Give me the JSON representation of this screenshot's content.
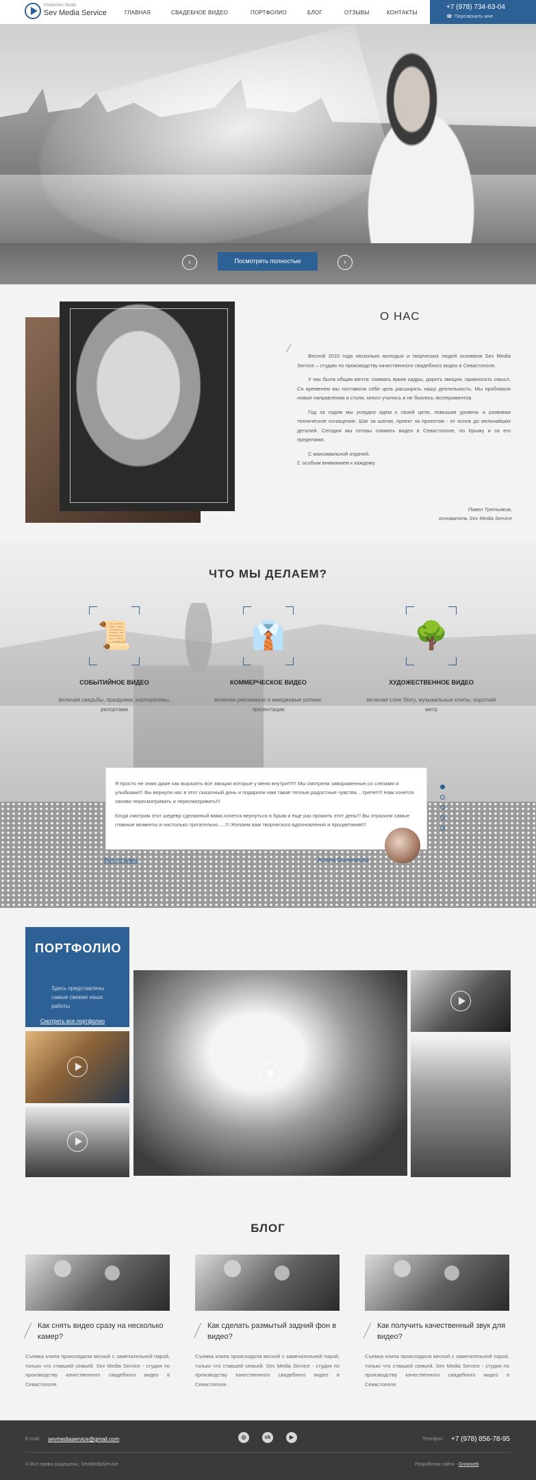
{
  "header": {
    "logo_small": "Production Studio",
    "logo_big": "Sev Media Service",
    "nav": [
      "ГЛАВНАЯ",
      "СВАДЕБНОЕ ВИДЕО",
      "ПОРТФОЛИО",
      "БЛОГ",
      "ОТЗЫВЫ",
      "КОНТАКТЫ"
    ],
    "phone": "+7 (978) 734-63-04",
    "callback": "Перезвонить мне"
  },
  "hero": {
    "button": "Посмотреть полностью",
    "prev_arrow": "‹",
    "next_arrow": "›"
  },
  "about": {
    "title": "О НАС",
    "paragraphs": [
      "Весной 2010 года несколько молодых и творческих людей основали Sev Media Service – студию по производству качественного свадебного видео в Севастополе.",
      "У нас была общая мечта: снимать яркие кадры, дарить эмоции, привносить смысл. Со временем мы поставили себе цель расширить нашу деятельность. Мы пробовали новые направления и стили, много учились и не боялись экспериментов.",
      "Год за годом мы усердно идем к своей цели, повышая уровень и развивая техническое оснащение. Шаг за шагом, проект за проектом - от основ до мельчайших деталей. Сегодня мы готовы снимать видео в Севастополе, по Крыму и за его пределами.",
      "С максимальной отдачей.\nС особым вниманием к каждому."
    ],
    "sign_name": "Павел Третьяков,",
    "sign_role": "основатель Sev Media Service"
  },
  "services": {
    "title": "ЧТО МЫ ДЕЛАЕМ?",
    "items": [
      {
        "icon": "scroll-icon",
        "glyph": "📜",
        "title": "СОБЫТИЙНОЕ ВИДЕО",
        "desc": "включая свадьбы, праздники, корпоративы, репортажи"
      },
      {
        "icon": "tie-icon",
        "glyph": "👔",
        "title": "КОММЕРЧЕСКОЕ ВИДЕО",
        "desc": "включая рекламные и имиджевые ролики, презентации"
      },
      {
        "icon": "tree-icon",
        "glyph": "🌳",
        "title": "ХУДОЖЕСТВЕННОЕ ВИДЕО",
        "desc": "включая Love Story, музыкальные клипы, короткий метр"
      }
    ]
  },
  "review": {
    "p1": "Я просто не знаю даже как выразить все эмоции которые у меня внутри!!!!!! Мы смотрели завороженные,со слезами и улыбками!!! Вы вернули нас в этот сказочный день и подарили нам такие теплые,радостные чувства....трепет!!! Нам хочется заново пересматривать и пересматривать!!!",
    "p2": "Когда смотрим этот шедевр сделанный вами,хочется вернуться в Крым и еще раз прожить этот день!!! Вы отразили самые главные моменты и настолько трогательно.....!!! Желаем вам творческого вдохновления и процветания!!!",
    "all_link": "Все отзывы",
    "author": "Алина Быченкова"
  },
  "portfolio": {
    "title": "ПОРТФОЛИО",
    "desc": "Здесь представлены самые свежие наши работы",
    "link": "Смотреть все портфолио"
  },
  "blog": {
    "title": "БЛОГ",
    "posts": [
      {
        "title": "Как снять видео сразу на несколько камер?",
        "text": "Съемка клипа происходила весной с замечательной парой, только что ставшей семьей. Sev Media Service - студия по производству качественного свадебного видео в Севастополе."
      },
      {
        "title": "Как сделать размытый задний фон в видео?",
        "text": "Съемка клипа происходила весной с замечательной парой, только что ставшей семьей. Sev Media Service - студия по производству качественного свадебного видео в Севастополе."
      },
      {
        "title": "Как получить качественный звук для видео?",
        "text": "Съемка клипа происходила весной с замечательной парой, только что ставшей семьей. Sev Media Service - студия по производству качественного свадебного видео в Севастополе."
      }
    ]
  },
  "footer": {
    "email_label": "E-mail:",
    "email": "sevmediaservice@gmail.com",
    "phone_label": "Телефон:",
    "phone": "+7 (978) 856-78-95",
    "social": [
      "instagram-icon",
      "vk-icon",
      "youtube-icon"
    ],
    "social_glyphs": [
      "◎",
      "vk",
      "▶"
    ],
    "copyright": "© Все права защищены, SevMediaService",
    "dev_label": "Разработка сайта -",
    "dev_link": "Growweb"
  }
}
